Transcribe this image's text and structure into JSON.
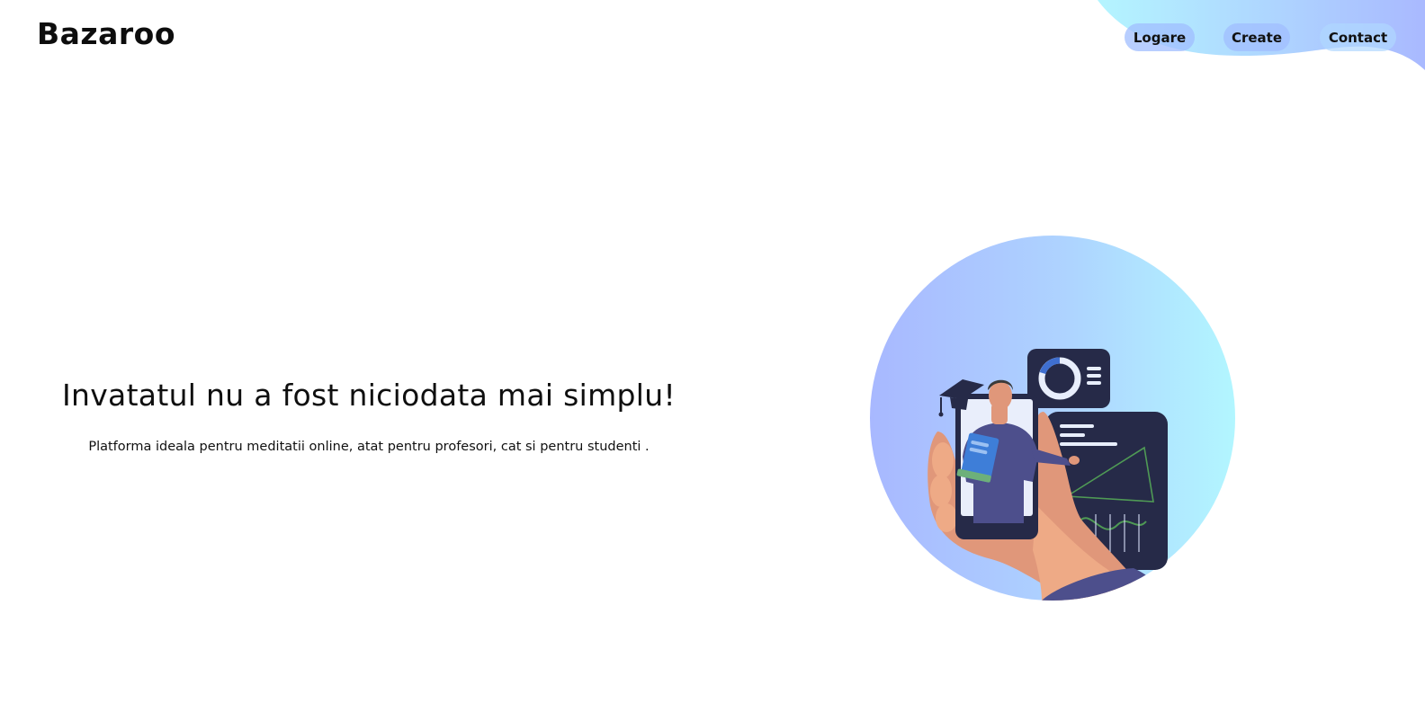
{
  "brand": {
    "name": "Bazaroo"
  },
  "nav": {
    "items": [
      {
        "label": "Logare"
      },
      {
        "label": "Create"
      },
      {
        "label": "Contact"
      }
    ]
  },
  "hero": {
    "title": "Invatatul nu a fost niciodata mai simplu!",
    "subtitle": "Platforma ideala pentru meditatii online, atat pentru profesori, cat si pentru studenti ."
  },
  "colors": {
    "accent_blue": "#a8bcff",
    "accent_cyan": "#b0f4ff",
    "nav_button": "#a0beff",
    "dark_panel": "#262a48",
    "text": "#111111"
  },
  "icons": {
    "illustration": "online-teacher-phone-illustration"
  }
}
